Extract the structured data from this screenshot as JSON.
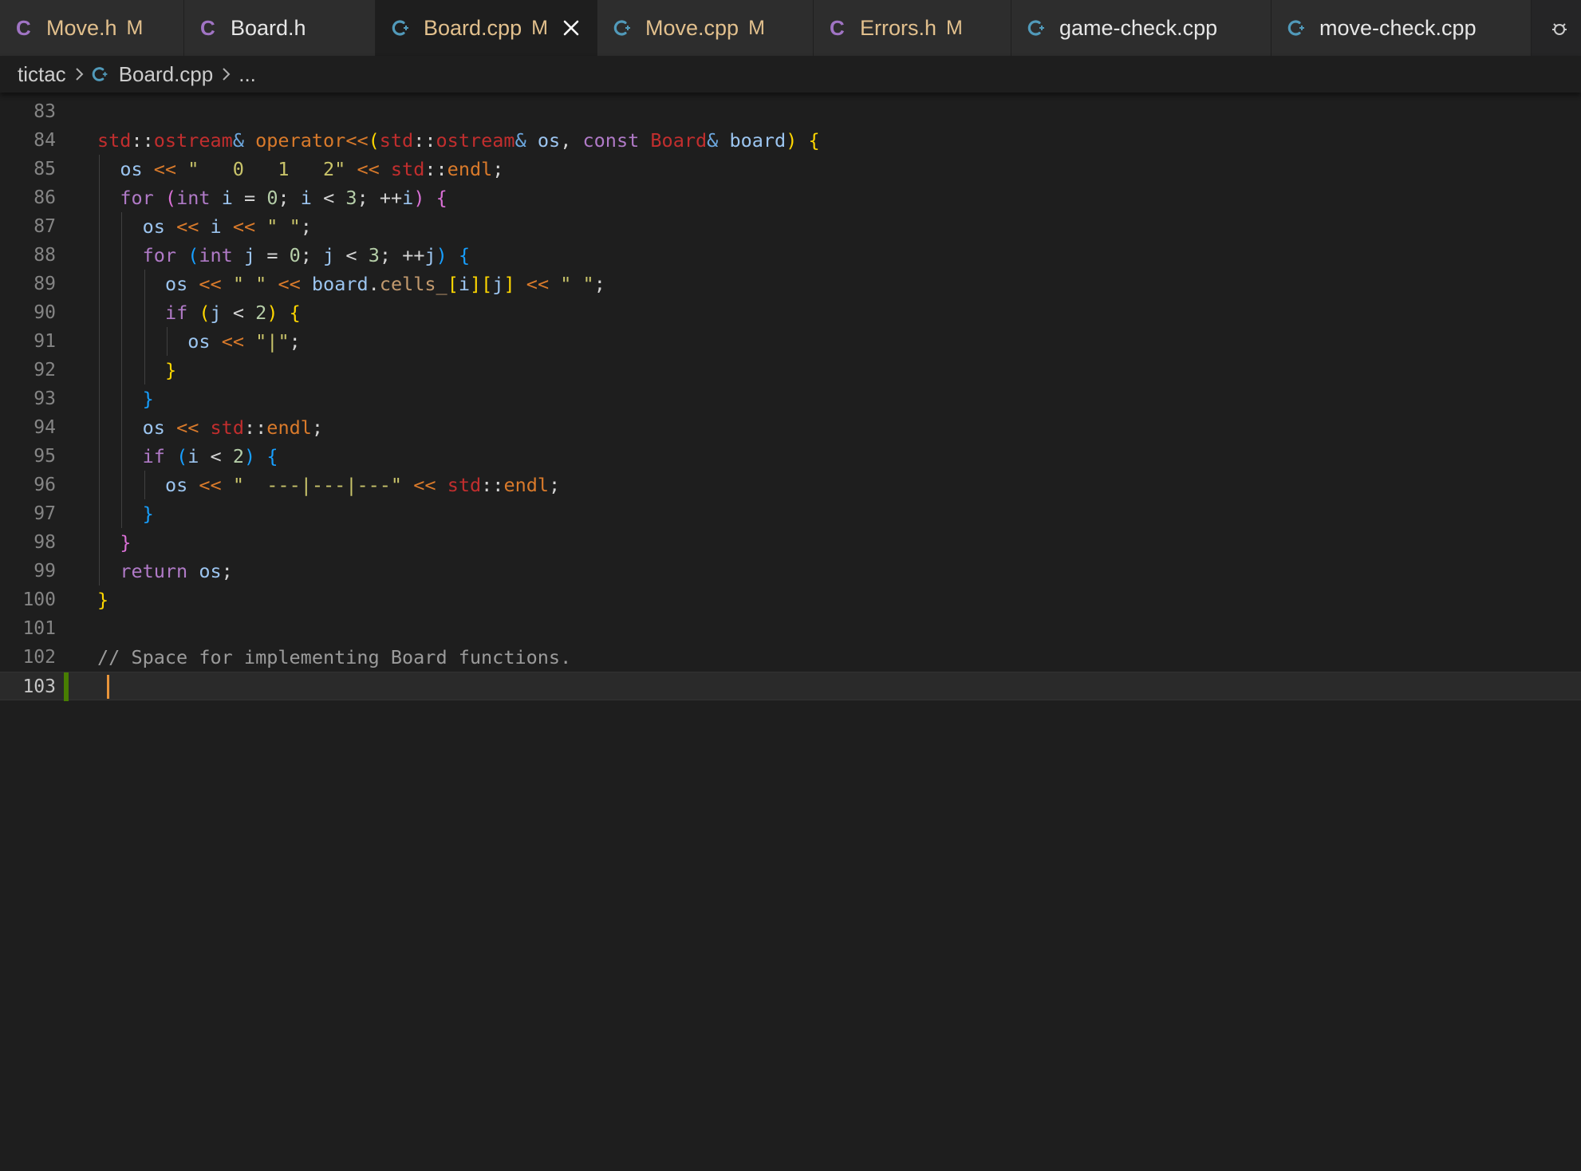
{
  "tabs": [
    {
      "name": "tab-move-h",
      "icon": "c-header-icon",
      "label": "Move.h",
      "badge": "M",
      "active": false
    },
    {
      "name": "tab-board-h",
      "icon": "c-header-icon",
      "label": "Board.h",
      "badge": "",
      "active": false
    },
    {
      "name": "tab-board-cpp",
      "icon": "cpp-file-icon",
      "label": "Board.cpp",
      "badge": "M",
      "active": true
    },
    {
      "name": "tab-move-cpp",
      "icon": "cpp-file-icon",
      "label": "Move.cpp",
      "badge": "M",
      "active": false
    },
    {
      "name": "tab-errors-h",
      "icon": "c-header-icon",
      "label": "Errors.h",
      "badge": "M",
      "active": false
    },
    {
      "name": "tab-game-check-cpp",
      "icon": "cpp-file-icon",
      "label": "game-check.cpp",
      "badge": "",
      "active": false
    },
    {
      "name": "tab-move-check-cpp",
      "icon": "cpp-file-icon",
      "label": "move-check.cpp",
      "badge": "",
      "active": false
    }
  ],
  "breadcrumb": {
    "folder": "tictac",
    "file": "Board.cpp",
    "symbol": "..."
  },
  "editor": {
    "language": "cpp",
    "current_line": 103,
    "lines": [
      {
        "n": "83",
        "text": ""
      },
      {
        "n": "84",
        "text": "std::ostream& operator<<(std::ostream& os, const Board& board) {"
      },
      {
        "n": "85",
        "text": "  os << \"   0   1   2\" << std::endl;"
      },
      {
        "n": "86",
        "text": "  for (int i = 0; i < 3; ++i) {"
      },
      {
        "n": "87",
        "text": "    os << i << \" \";"
      },
      {
        "n": "88",
        "text": "    for (int j = 0; j < 3; ++j) {"
      },
      {
        "n": "89",
        "text": "      os << \" \" << board.cells_[i][j] << \" \";"
      },
      {
        "n": "90",
        "text": "      if (j < 2) {"
      },
      {
        "n": "91",
        "text": "        os << \"|\";"
      },
      {
        "n": "92",
        "text": "      }"
      },
      {
        "n": "93",
        "text": "    }"
      },
      {
        "n": "94",
        "text": "    os << std::endl;"
      },
      {
        "n": "95",
        "text": "    if (i < 2) {"
      },
      {
        "n": "96",
        "text": "      os << \"  ---|---|---\" << std::endl;"
      },
      {
        "n": "97",
        "text": "    }"
      },
      {
        "n": "98",
        "text": "  }"
      },
      {
        "n": "99",
        "text": "  return os;"
      },
      {
        "n": "100",
        "text": "}"
      },
      {
        "n": "101",
        "text": ""
      },
      {
        "n": "102",
        "text": "// Space for implementing Board functions."
      },
      {
        "n": "103",
        "text": ""
      }
    ]
  },
  "colors": {
    "editor_bg": "#1e1e1e",
    "tab_inactive_bg": "#2d2d2d",
    "modified": "#e2c08d",
    "cursor": "#e8943a",
    "git_added": "#487e02"
  }
}
